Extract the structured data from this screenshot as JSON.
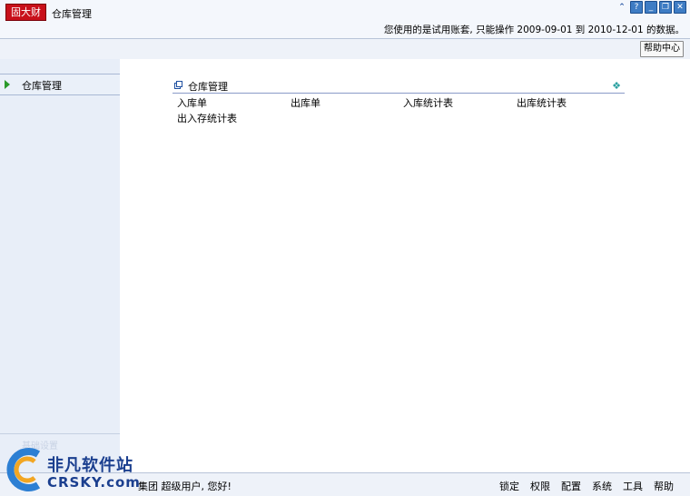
{
  "app": {
    "logo": "固大财",
    "module_title": "仓库管理",
    "trial_notice": "您使用的是试用账套, 只能操作 2009-09-01 到 2010-12-01 的数据。"
  },
  "window_controls": [
    "collapse-icon",
    "help-icon",
    "minimize-icon",
    "restore-icon",
    "close-icon"
  ],
  "toolbar": {
    "help_center": "帮助中心"
  },
  "sidebar": {
    "items": [
      {
        "label": "仓库管理",
        "icon": "arrow-right-icon"
      },
      {
        "label": "基础设置"
      }
    ]
  },
  "panel": {
    "title": "仓库管理",
    "links": [
      "入库单",
      "出库单",
      "入库统计表",
      "出库统计表",
      "出入存统计表"
    ]
  },
  "status": {
    "greeting": "集团 超级用户, 您好!",
    "menu": [
      "锁定",
      "权限",
      "配置",
      "系统",
      "工具",
      "帮助"
    ]
  },
  "watermark": {
    "line1": "非凡软件站",
    "line2": "CRSKY.com"
  },
  "colors": {
    "logo_bg": "#c8101a",
    "accent": "#1e4fa0",
    "sidebar_bg": "#e8eef8"
  }
}
